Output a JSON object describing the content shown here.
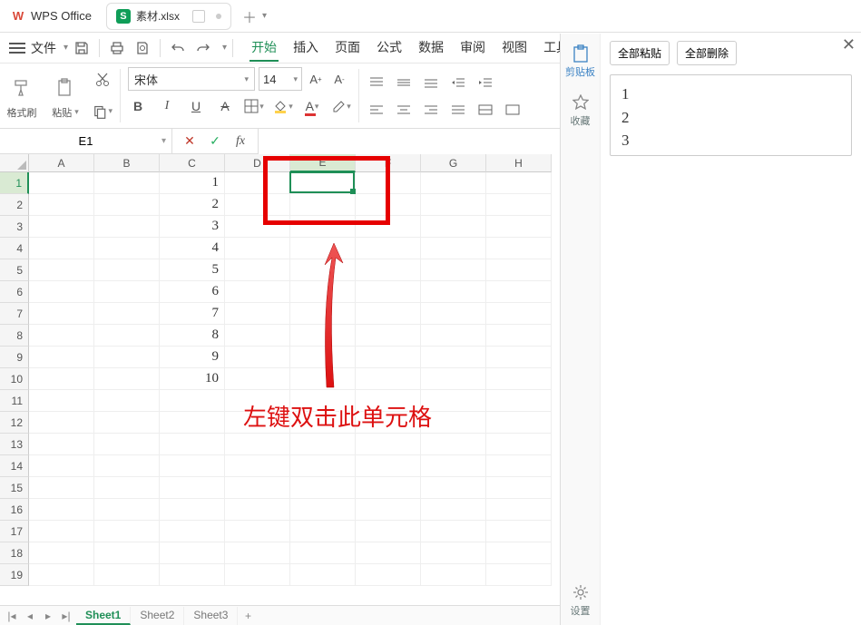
{
  "app": {
    "name": "WPS Office"
  },
  "doc": {
    "name": "素材.xlsx",
    "icon_letter": "S"
  },
  "quick_access": {
    "file_menu": "文件"
  },
  "menus": [
    "开始",
    "插入",
    "页面",
    "公式",
    "数据",
    "审阅",
    "视图",
    "工具"
  ],
  "active_menu_index": 0,
  "ribbon": {
    "format_painter": "格式刷",
    "paste": "粘贴",
    "font_name": "宋体",
    "font_size": "14"
  },
  "name_box": "E1",
  "columns": [
    "A",
    "B",
    "C",
    "D",
    "E",
    "F",
    "G",
    "H"
  ],
  "row_count": 19,
  "col_c_values": [
    "1",
    "2",
    "3",
    "4",
    "5",
    "6",
    "7",
    "8",
    "9",
    "10"
  ],
  "selected_cell": {
    "colIndex": 4,
    "rowIndex": 0
  },
  "annotation": {
    "text": "左键双击此单元格"
  },
  "sheets": [
    "Sheet1",
    "Sheet2",
    "Sheet3"
  ],
  "active_sheet_index": 0,
  "clipboard": {
    "side": {
      "clipboard": "剪贴板",
      "favorite": "收藏",
      "settings": "设置"
    },
    "paste_all": "全部粘贴",
    "delete_all": "全部删除",
    "item_lines": [
      "1",
      "2",
      "3"
    ]
  }
}
